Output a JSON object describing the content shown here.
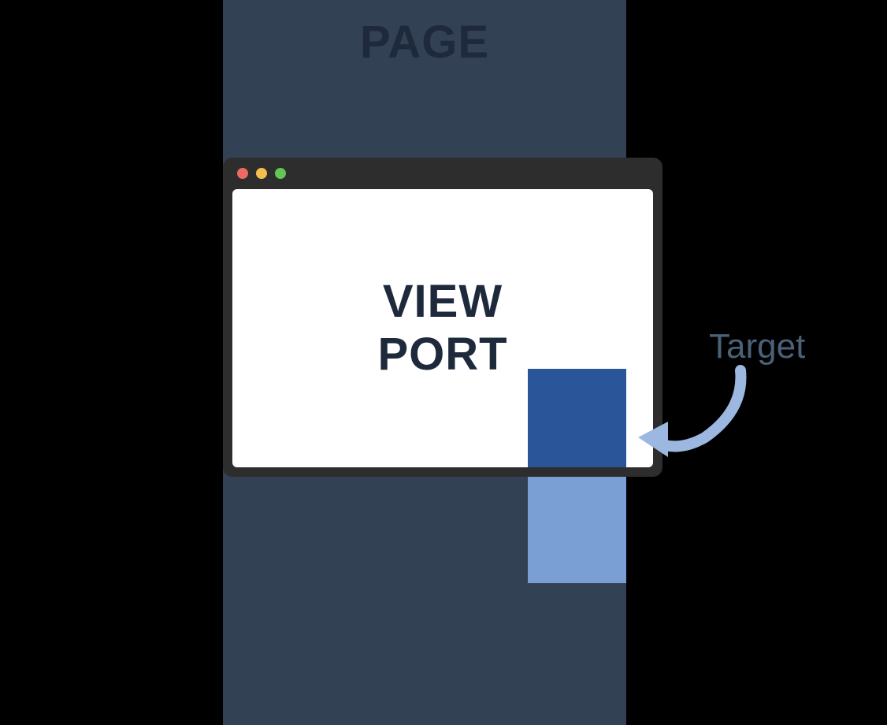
{
  "page": {
    "label": "PAGE"
  },
  "viewport": {
    "label_line1": "VIEW",
    "label_line2": "PORT"
  },
  "target": {
    "label": "Target"
  },
  "colors": {
    "page_background": "#334155",
    "page_label": "#1e293b",
    "window_chrome": "#2d2d2d",
    "viewport_content_bg": "#ffffff",
    "viewport_label": "#1e293b",
    "target_visible": "#2a5599",
    "target_hidden": "#7a9fd4",
    "target_label": "#4a6178",
    "arrow": "#9db8e0",
    "traffic_red": "#ed6a5e",
    "traffic_yellow": "#f5bf4f",
    "traffic_green": "#62c554"
  }
}
